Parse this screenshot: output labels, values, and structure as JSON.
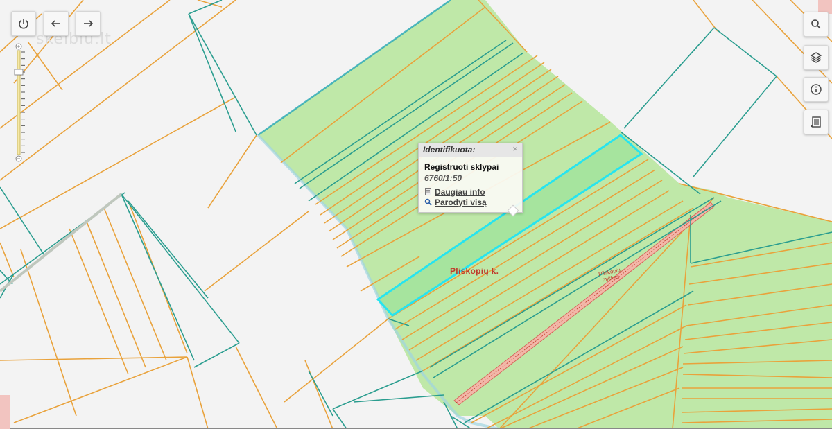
{
  "watermark": "skelbiu.lt",
  "controls": {
    "power_icon": "power-icon",
    "back_icon": "arrow-left-icon",
    "forward_icon": "arrow-right-icon",
    "search_icon": "search-icon",
    "layers_icon": "layers-icon",
    "info_icon": "info-icon",
    "legend_icon": "document-icon"
  },
  "zoom": {
    "level_fraction": 0.2
  },
  "popup": {
    "header": "Identifikuota:",
    "close": "×",
    "layer_title": "Registruoti sklypai",
    "parcel_id": "6760/1:50",
    "more_info": "Daugiau info",
    "show_all": "Parodyti visą"
  },
  "map_labels": {
    "village": "Pliskopių k.",
    "forest": "Pliskopių miškas"
  },
  "colors": {
    "orange_boundary": "#e9a23b",
    "teal_boundary": "#2a9d8f",
    "green_fill": "#bfe8a8",
    "highlight": "#26e4ef",
    "background": "#f3f3f3"
  }
}
